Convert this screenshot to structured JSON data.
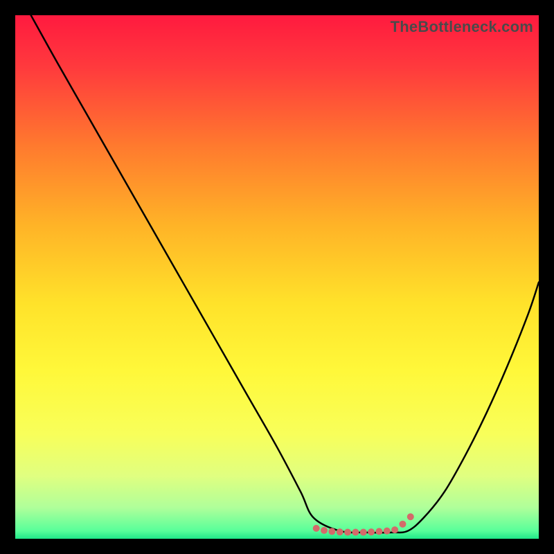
{
  "watermark": "TheBottleneck.com",
  "chart_data": {
    "type": "line",
    "title": "",
    "xlabel": "",
    "ylabel": "",
    "xlim": [
      0,
      100
    ],
    "ylim": [
      0,
      100
    ],
    "grid": false,
    "legend": false,
    "background_gradient": {
      "stops": [
        {
          "offset": 0.0,
          "color": "#ff1a3f"
        },
        {
          "offset": 0.1,
          "color": "#ff3a3d"
        },
        {
          "offset": 0.25,
          "color": "#ff7a2e"
        },
        {
          "offset": 0.4,
          "color": "#ffb327"
        },
        {
          "offset": 0.55,
          "color": "#ffe22a"
        },
        {
          "offset": 0.68,
          "color": "#fff83a"
        },
        {
          "offset": 0.8,
          "color": "#f8ff5a"
        },
        {
          "offset": 0.88,
          "color": "#e0ff80"
        },
        {
          "offset": 0.94,
          "color": "#b0ff9a"
        },
        {
          "offset": 0.985,
          "color": "#58ff9a"
        },
        {
          "offset": 1.0,
          "color": "#20e889"
        }
      ]
    },
    "series": [
      {
        "name": "bottleneck-curve",
        "stroke": "#000000",
        "stroke_width": 2.5,
        "x": [
          3,
          8,
          14,
          20,
          26,
          32,
          38,
          44,
          50,
          54.5,
          57,
          62,
          67,
          72,
          75,
          78,
          82,
          86,
          90,
          94,
          98,
          100
        ],
        "y": [
          100,
          91,
          80.5,
          70,
          59.5,
          49,
          38.5,
          28,
          17.5,
          9,
          4,
          1.5,
          1.2,
          1.2,
          1.5,
          4,
          9,
          16,
          24,
          33,
          43,
          49
        ]
      }
    ],
    "markers": {
      "name": "sweet-spot-dots",
      "fill": "#d46a6a",
      "radius_px": 5,
      "x": [
        57.5,
        59,
        60.5,
        62,
        63.5,
        65,
        66.5,
        68,
        69.5,
        71,
        72.5,
        74,
        75.5
      ],
      "y": [
        2.0,
        1.6,
        1.4,
        1.3,
        1.25,
        1.25,
        1.25,
        1.3,
        1.4,
        1.5,
        1.7,
        2.8,
        4.2
      ]
    }
  }
}
